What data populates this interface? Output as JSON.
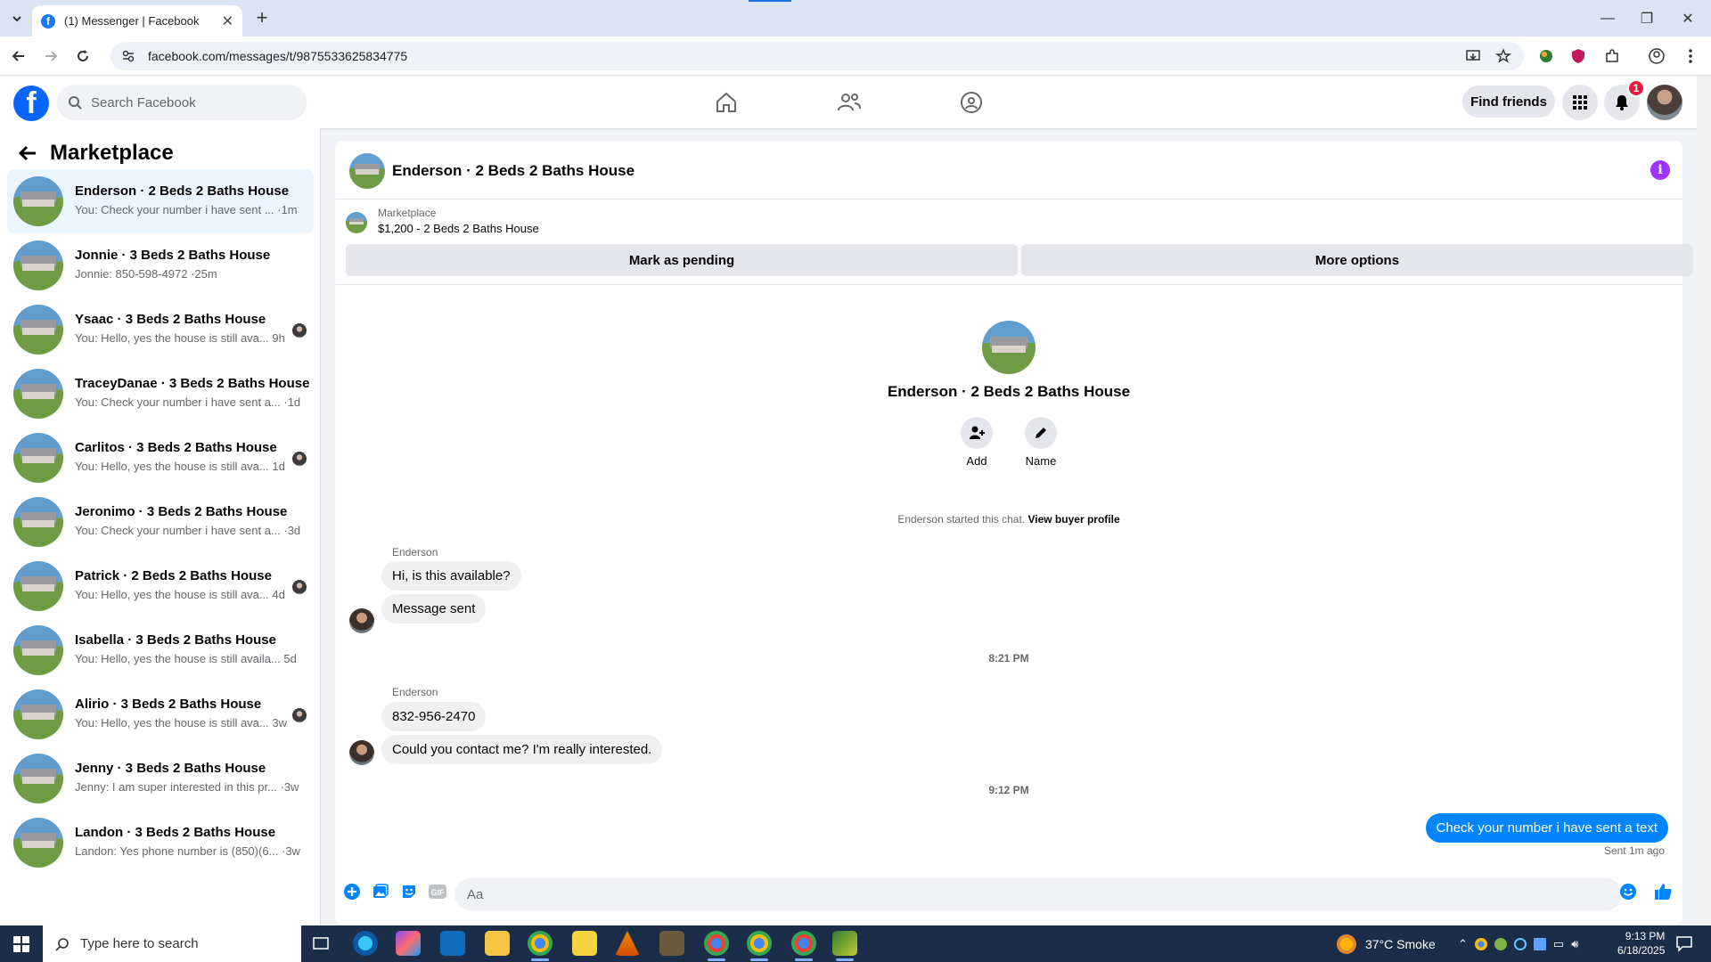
{
  "browser": {
    "tab_title": "(1) Messenger | Facebook",
    "url": "facebook.com/messages/t/9875533625834775"
  },
  "fb_header": {
    "search_placeholder": "Search Facebook",
    "find_friends_label": "Find friends",
    "notification_count": "1"
  },
  "sidebar": {
    "title": "Marketplace",
    "conversations": [
      {
        "name": "Enderson · 2 Beds 2 Baths House",
        "preview": "You: Check your number i have sent ... ·1m",
        "active": true,
        "seen": false
      },
      {
        "name": "Jonnie · 3 Beds 2 Baths House",
        "preview": "Jonnie: 850-598-4972 ·25m",
        "active": false,
        "seen": false
      },
      {
        "name": "Ysaac · 3 Beds 2 Baths House",
        "preview": "You: Hello, yes the house is still ava...  9h",
        "active": false,
        "seen": true
      },
      {
        "name": "TraceyDanae · 3 Beds 2 Baths House",
        "preview": "You: Check your number i have sent a... ·1d",
        "active": false,
        "seen": false
      },
      {
        "name": "Carlitos · 3 Beds 2 Baths House",
        "preview": "You: Hello, yes the house is still ava...  1d",
        "active": false,
        "seen": true
      },
      {
        "name": "Jeronimo · 3 Beds 2 Baths House",
        "preview": "You: Check your number i have sent a... ·3d",
        "active": false,
        "seen": false
      },
      {
        "name": "Patrick · 2 Beds 2 Baths House",
        "preview": "You: Hello, yes the house is still ava...  4d",
        "active": false,
        "seen": true
      },
      {
        "name": "Isabella · 3 Beds 2 Baths House",
        "preview": "You: Hello, yes the house is still availa...  5d",
        "active": false,
        "seen": false
      },
      {
        "name": "Alirio · 3 Beds 2 Baths House",
        "preview": "You: Hello, yes the house is still ava...  3w",
        "active": false,
        "seen": true
      },
      {
        "name": "Jenny · 3 Beds 2 Baths House",
        "preview": "Jenny: I am super interested in this pr... ·3w",
        "active": false,
        "seen": false
      },
      {
        "name": "Landon · 3 Beds 2 Baths House",
        "preview": "Landon: Yes phone number is (850)(6... ·3w",
        "active": false,
        "seen": false
      }
    ]
  },
  "chat": {
    "title": "Enderson · 2 Beds 2 Baths House",
    "listing_category": "Marketplace",
    "listing_info": "$1,200 - 2 Beds 2 Baths House",
    "mark_pending_label": "Mark as pending",
    "more_options_label": "More options",
    "intro_name": "Enderson · 2 Beds 2 Baths House",
    "add_label": "Add",
    "name_label": "Name",
    "started_text": "Enderson started this chat.",
    "view_profile_label": "View buyer profile",
    "sender_name": "Enderson",
    "msg1": "Hi, is this available?",
    "msg2": "Message sent",
    "time1": "8:21 PM",
    "sender_name_2": "Enderson",
    "msg3": "832-956-2470",
    "msg4": "Could you contact me? I'm really interested.",
    "time2": "9:12 PM",
    "my_msg": "Check your number i have sent a text",
    "sent_status": "Sent 1m ago",
    "input_placeholder": "Aa"
  },
  "taskbar": {
    "search_placeholder": "Type here to search",
    "weather": "37°C  Smoke",
    "time": "9:13 PM",
    "date": "6/18/2025"
  },
  "colors": {
    "fb_blue": "#0866ff",
    "messenger_blue": "#0084ff",
    "info_purple": "#a033ff",
    "badge_red": "#e41e3f"
  }
}
